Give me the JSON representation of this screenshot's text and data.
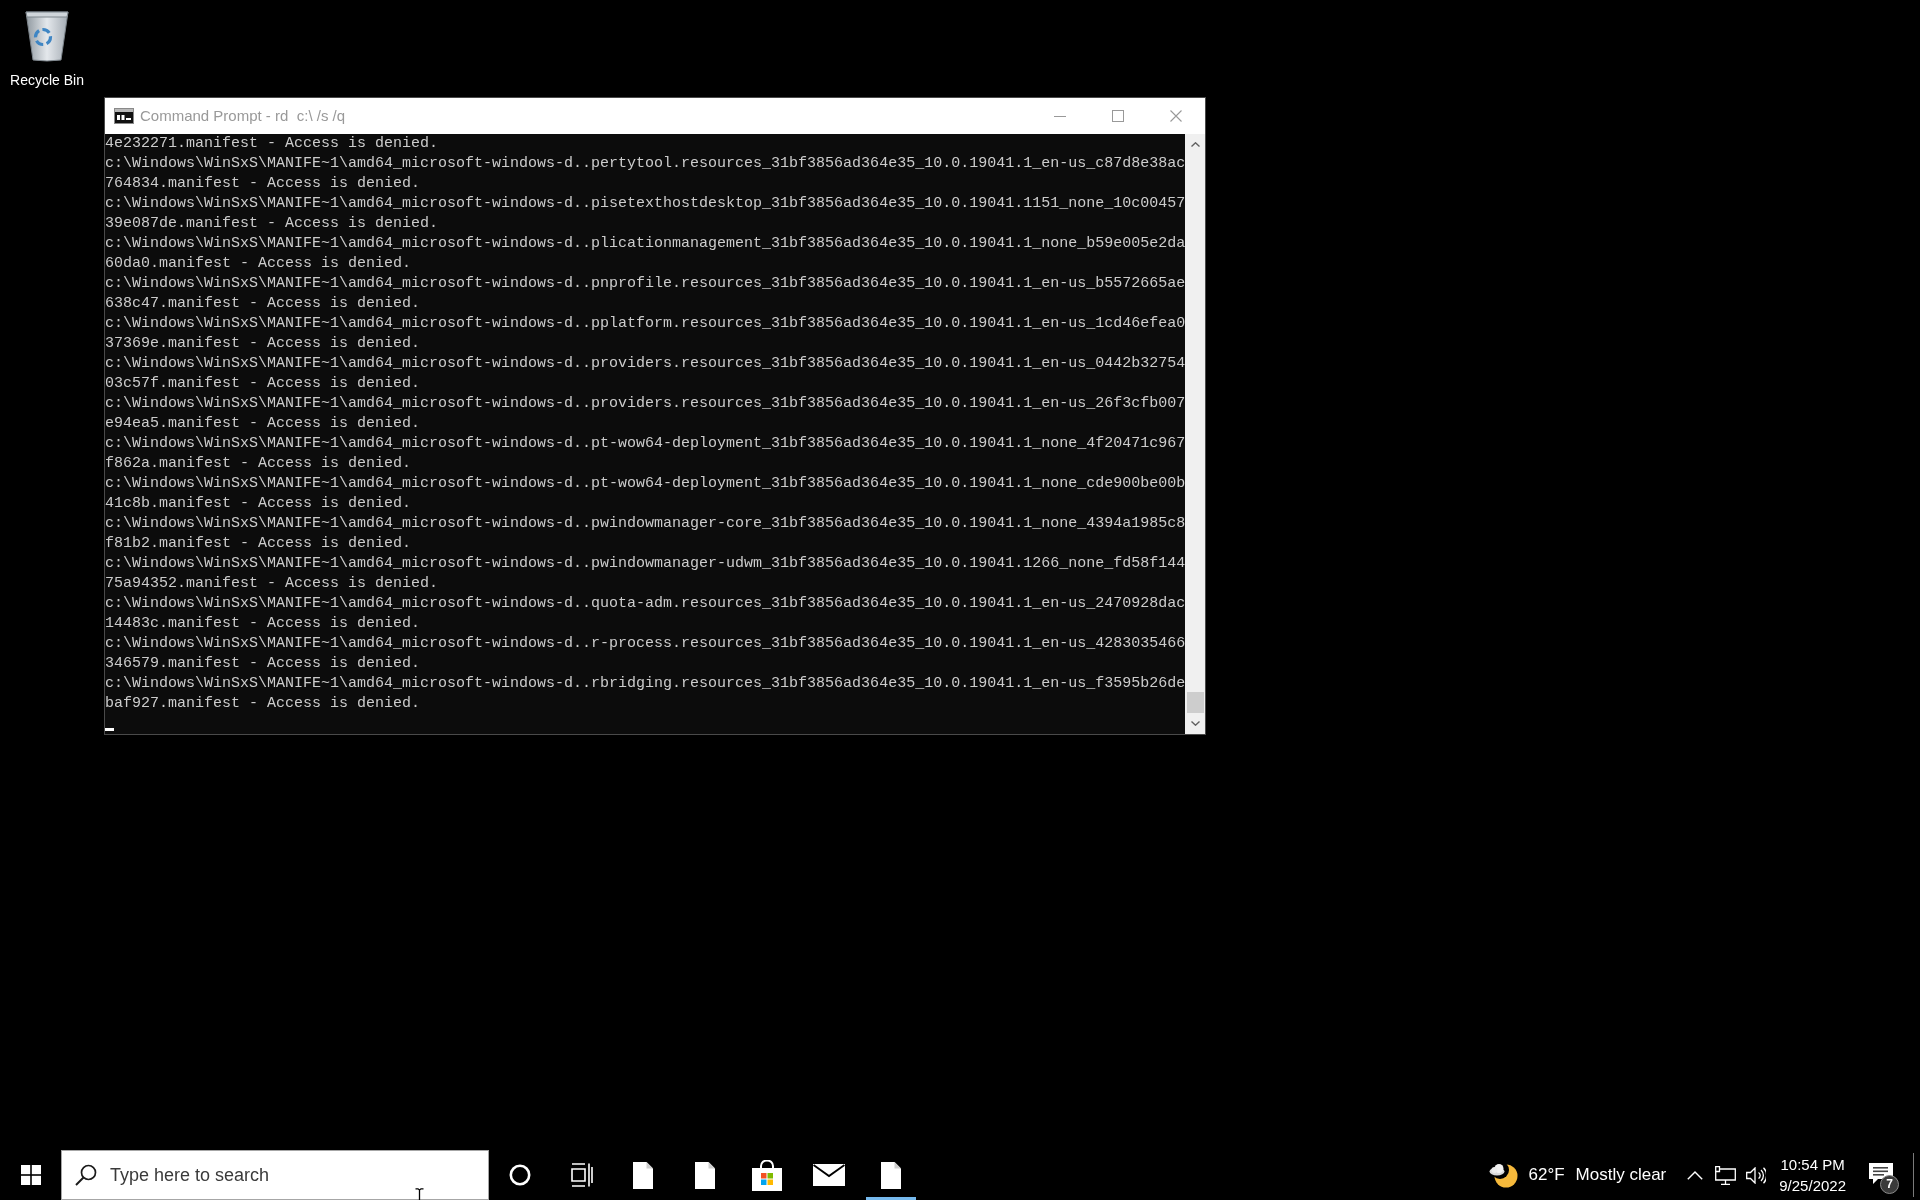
{
  "desktop_icons": [
    {
      "label": "Recycle Bin"
    }
  ],
  "window": {
    "title": "Command Prompt - rd  c:\\ /s /q",
    "focused": false,
    "lines": [
      "4e232271.manifest - Access is denied.",
      "c:\\Windows\\WinSxS\\MANIFE~1\\amd64_microsoft-windows-d..pertytool.resources_31bf3856ad364e35_10.0.19041.1_en-us_c87d8e38ac",
      "764834.manifest - Access is denied.",
      "c:\\Windows\\WinSxS\\MANIFE~1\\amd64_microsoft-windows-d..pisetexthostdesktop_31bf3856ad364e35_10.0.19041.1151_none_10c00457",
      "39e087de.manifest - Access is denied.",
      "c:\\Windows\\WinSxS\\MANIFE~1\\amd64_microsoft-windows-d..plicationmanagement_31bf3856ad364e35_10.0.19041.1_none_b59e005e2da",
      "60da0.manifest - Access is denied.",
      "c:\\Windows\\WinSxS\\MANIFE~1\\amd64_microsoft-windows-d..pnprofile.resources_31bf3856ad364e35_10.0.19041.1_en-us_b5572665ae",
      "638c47.manifest - Access is denied.",
      "c:\\Windows\\WinSxS\\MANIFE~1\\amd64_microsoft-windows-d..pplatform.resources_31bf3856ad364e35_10.0.19041.1_en-us_1cd46efea0",
      "37369e.manifest - Access is denied.",
      "c:\\Windows\\WinSxS\\MANIFE~1\\amd64_microsoft-windows-d..providers.resources_31bf3856ad364e35_10.0.19041.1_en-us_0442b32754",
      "03c57f.manifest - Access is denied.",
      "c:\\Windows\\WinSxS\\MANIFE~1\\amd64_microsoft-windows-d..providers.resources_31bf3856ad364e35_10.0.19041.1_en-us_26f3cfb007",
      "e94ea5.manifest - Access is denied.",
      "c:\\Windows\\WinSxS\\MANIFE~1\\amd64_microsoft-windows-d..pt-wow64-deployment_31bf3856ad364e35_10.0.19041.1_none_4f20471c967",
      "f862a.manifest - Access is denied.",
      "c:\\Windows\\WinSxS\\MANIFE~1\\amd64_microsoft-windows-d..pt-wow64-deployment_31bf3856ad364e35_10.0.19041.1_none_cde900be00b",
      "41c8b.manifest - Access is denied.",
      "c:\\Windows\\WinSxS\\MANIFE~1\\amd64_microsoft-windows-d..pwindowmanager-core_31bf3856ad364e35_10.0.19041.1_none_4394a1985c8",
      "f81b2.manifest - Access is denied.",
      "c:\\Windows\\WinSxS\\MANIFE~1\\amd64_microsoft-windows-d..pwindowmanager-udwm_31bf3856ad364e35_10.0.19041.1266_none_fd58f144",
      "75a94352.manifest - Access is denied.",
      "c:\\Windows\\WinSxS\\MANIFE~1\\amd64_microsoft-windows-d..quota-adm.resources_31bf3856ad364e35_10.0.19041.1_en-us_2470928dac",
      "14483c.manifest - Access is denied.",
      "c:\\Windows\\WinSxS\\MANIFE~1\\amd64_microsoft-windows-d..r-process.resources_31bf3856ad364e35_10.0.19041.1_en-us_4283035466",
      "346579.manifest - Access is denied.",
      "c:\\Windows\\WinSxS\\MANIFE~1\\amd64_microsoft-windows-d..rbridging.resources_31bf3856ad364e35_10.0.19041.1_en-us_f3595b26de",
      "baf927.manifest - Access is denied."
    ]
  },
  "taskbar": {
    "search": {
      "placeholder": "Type here to search"
    },
    "apps": [
      {
        "kind": "document",
        "open": false
      },
      {
        "kind": "document",
        "open": false
      },
      {
        "kind": "store",
        "open": false
      },
      {
        "kind": "mail",
        "open": false
      },
      {
        "kind": "document",
        "open": true
      }
    ],
    "weather": {
      "temperature": "62°F",
      "condition": "Mostly clear"
    },
    "clock": {
      "time": "10:54 PM",
      "date": "9/25/2022"
    },
    "notifications": {
      "count": "7"
    }
  }
}
